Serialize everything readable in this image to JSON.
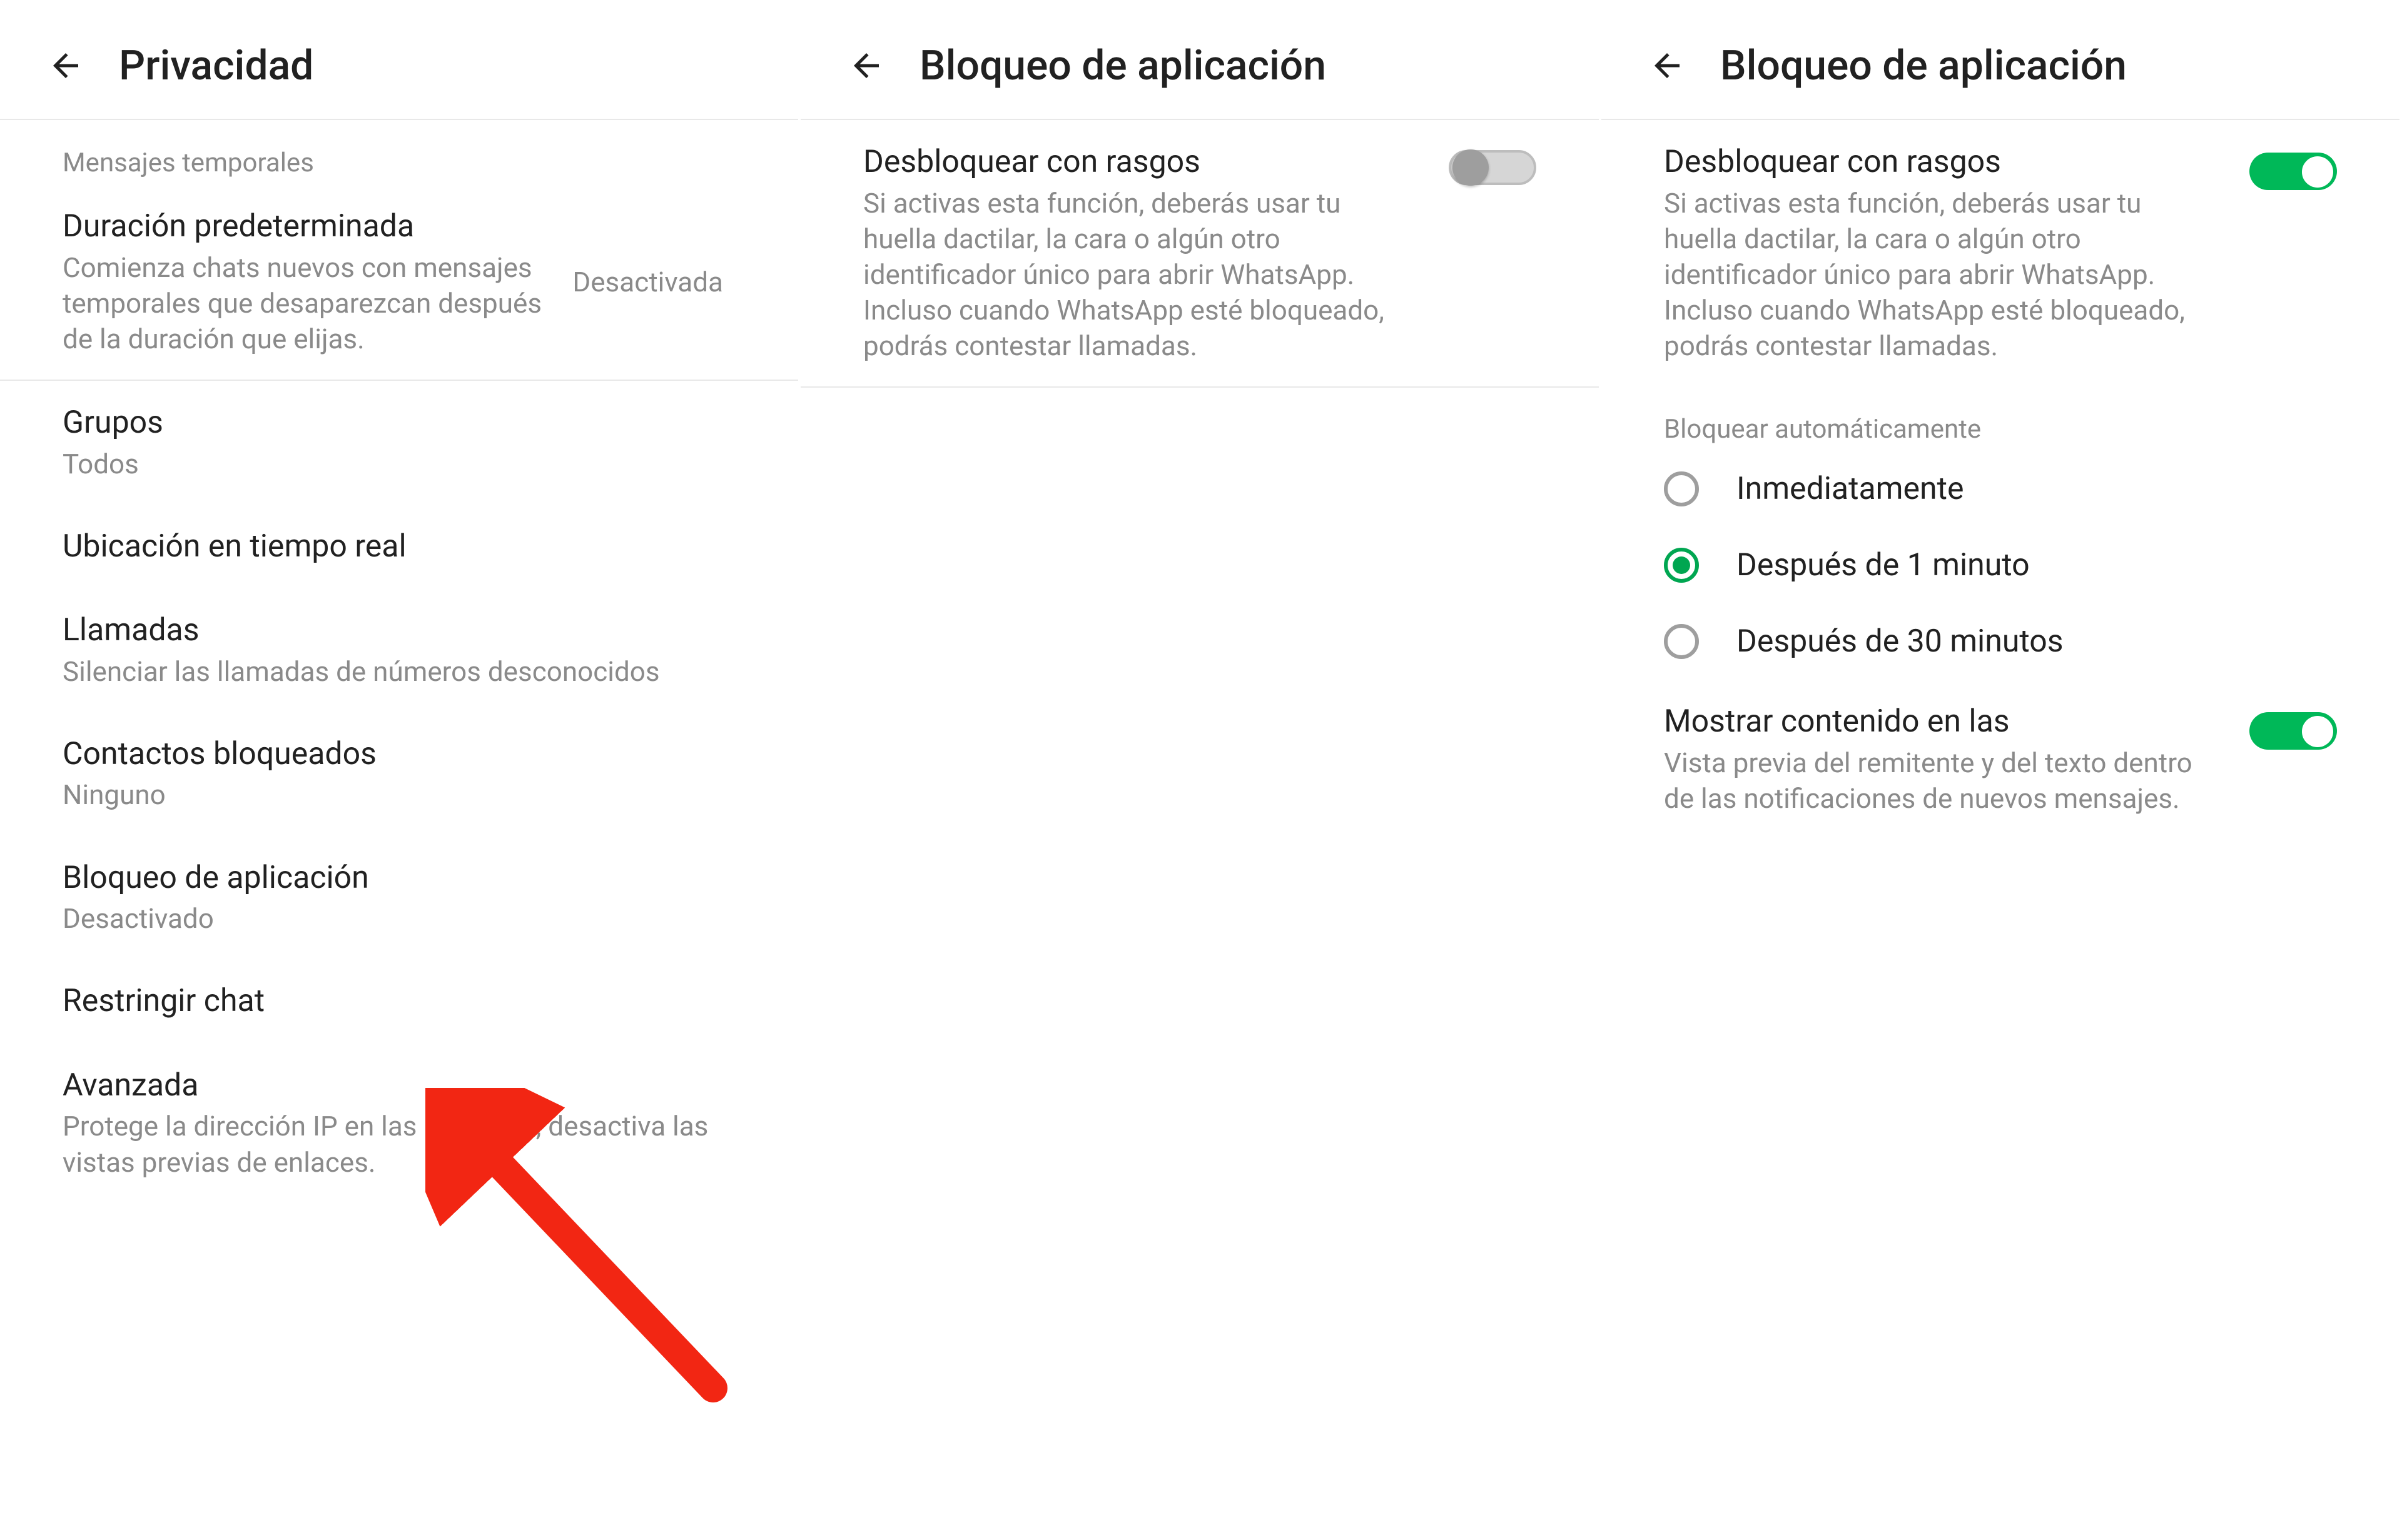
{
  "panel1": {
    "header_title": "Privacidad",
    "section1_header": "Mensajes temporales",
    "duration_title": "Duración predeterminada",
    "duration_sub": "Comienza chats nuevos con mensajes temporales que desaparezcan después de la duración que elijas.",
    "duration_value": "Desactivada",
    "groups_title": "Grupos",
    "groups_sub": "Todos",
    "location_title": "Ubicación en tiempo real",
    "calls_title": "Llamadas",
    "calls_sub": "Silenciar las llamadas de números desconocidos",
    "blocked_title": "Contactos bloqueados",
    "blocked_sub": "Ninguno",
    "applock_title": "Bloqueo de aplicación",
    "applock_sub": "Desactivado",
    "restrict_title": "Restringir chat",
    "advanced_title": "Avanzada",
    "advanced_sub": "Protege la dirección IP en las llamadas, desactiva las vistas previas de enlaces."
  },
  "panel2": {
    "header_title": "Bloqueo de aplicación",
    "unlock_title": "Desbloquear con rasgos",
    "unlock_desc": "Si activas esta función, deberás usar tu huella dactilar, la cara o algún otro identificador único para abrir WhatsApp. Incluso cuando WhatsApp esté bloqueado, podrás contestar llamadas.",
    "toggle_state": "off"
  },
  "panel3": {
    "header_title": "Bloqueo de aplicación",
    "unlock_title": "Desbloquear con rasgos",
    "unlock_desc": "Si activas esta función, deberás usar tu huella dactilar, la cara o algún otro identificador único para abrir WhatsApp. Incluso cuando WhatsApp esté bloqueado, podrás contestar llamadas.",
    "toggle_state": "on",
    "auto_header": "Bloquear automáticamente",
    "radio_options": {
      "opt1": "Inmediatamente",
      "opt2": "Después de 1 minuto",
      "opt3": "Después de 30 minutos"
    },
    "selected_radio": "opt2",
    "show_title": "Mostrar contenido en las",
    "show_desc": "Vista previa del remitente y del texto dentro de las notificaciones de nuevos mensajes.",
    "show_toggle": "on"
  },
  "colors": {
    "accent": "#00a651",
    "toggle_on": "#00b858",
    "text_primary": "#212121",
    "text_secondary": "#8a8a8a",
    "annotation_red": "#f22613"
  }
}
